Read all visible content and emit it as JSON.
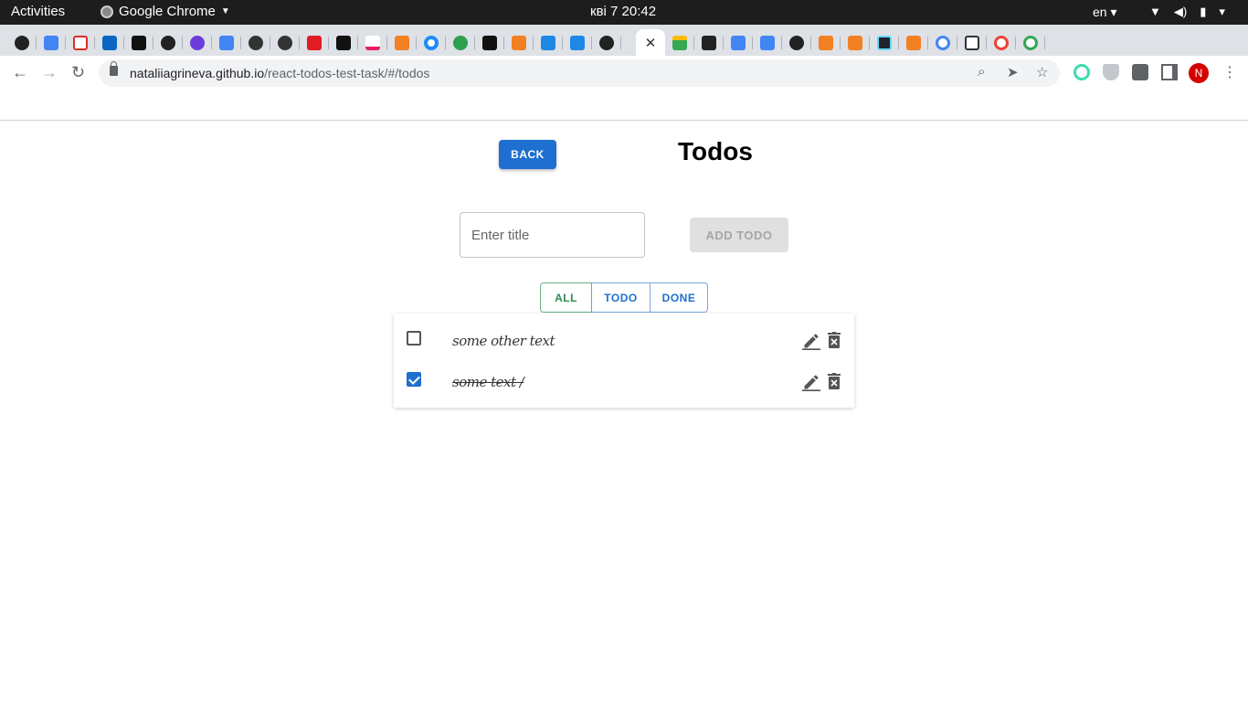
{
  "os_bar": {
    "activities": "Activities",
    "app_name": "Google Chrome",
    "clock": "кві 7  20:42",
    "language": "en"
  },
  "browser": {
    "active_tab_icon": "close-icon",
    "url_host": "nataliiagrineva.github.io",
    "url_path": "/react-todos-test-task/#/todos",
    "profile_initial": "N"
  },
  "page": {
    "back_label": "BACK",
    "title": "Todos",
    "input_placeholder": "Enter title",
    "add_label": "ADD TODO",
    "filters": [
      "ALL",
      "TODO",
      "DONE"
    ],
    "active_filter": "ALL",
    "todos": [
      {
        "text": "some other text",
        "done": false
      },
      {
        "text": "some text /",
        "done": true
      }
    ]
  },
  "colors": {
    "primary": "#1e6fd0",
    "active_filter": "#2e8b4e",
    "disabled_bg": "#e0e0e0"
  }
}
